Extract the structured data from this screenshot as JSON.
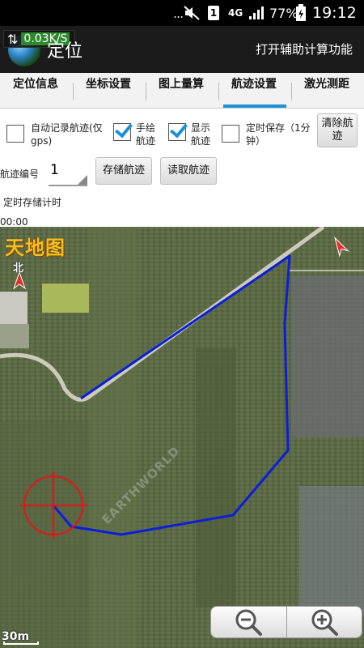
{
  "status_bar": {
    "dots": "...",
    "sim": "1",
    "network": "4G",
    "battery_pct": "77%",
    "time": "19:12"
  },
  "title_bar": {
    "speed": "0.03K/S",
    "title": "定位",
    "action": "打开辅助计算功能"
  },
  "tabs": [
    {
      "label": "定位信息",
      "active": false
    },
    {
      "label": "坐标设置",
      "active": false
    },
    {
      "label": "图上量算",
      "active": false
    },
    {
      "label": "航迹设置",
      "active": true
    },
    {
      "label": "激光测距",
      "active": false
    }
  ],
  "controls": {
    "auto_record": {
      "label": "自动记录航迹(仅gps)",
      "checked": false
    },
    "hand_draw": {
      "label": "手绘航迹",
      "checked": true
    },
    "show_track": {
      "label": "显示航迹",
      "checked": true
    },
    "timed_save": {
      "label": "定时保存（1分钟）",
      "checked": false
    },
    "clear_button": "清除航迹",
    "track_no_label": "航迹编号",
    "track_no_value": "1",
    "save_button": "存储航迹",
    "load_button": "读取航迹",
    "timer_label": "定时存储计时",
    "timer_value": "00:00"
  },
  "map": {
    "brand": "天地图",
    "north": "北",
    "scale": "30m",
    "watermark": "EARTHWORLD",
    "track_color": "#0d1fd6",
    "road_color": "#d8d6c8"
  }
}
